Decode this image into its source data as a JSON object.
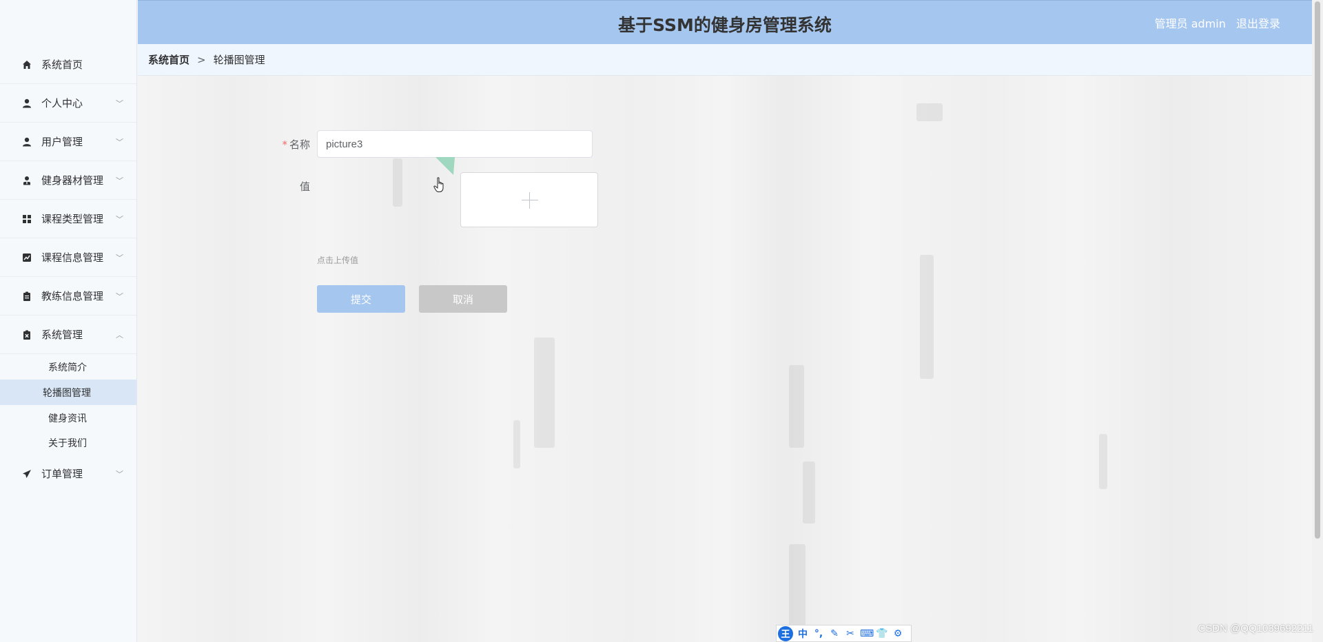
{
  "header": {
    "title": "基于SSM的健身房管理系统",
    "user_label": "管理员 admin",
    "logout_label": "退出登录"
  },
  "breadcrumb": {
    "home": "系统首页",
    "separator": ">",
    "current": "轮播图管理"
  },
  "sidebar": {
    "items": [
      {
        "label": "系统首页",
        "icon": "home-icon"
      },
      {
        "label": "个人中心",
        "icon": "user-icon",
        "expandable": true
      },
      {
        "label": "用户管理",
        "icon": "user-icon",
        "expandable": true
      },
      {
        "label": "健身器材管理",
        "icon": "user-tie-icon",
        "expandable": true
      },
      {
        "label": "课程类型管理",
        "icon": "grid-icon",
        "expandable": true
      },
      {
        "label": "课程信息管理",
        "icon": "chart-icon",
        "expandable": true
      },
      {
        "label": "教练信息管理",
        "icon": "clipboard-icon",
        "expandable": true
      },
      {
        "label": "系统管理",
        "icon": "clipboard-x-icon",
        "expandable": true,
        "expanded": true
      },
      {
        "label": "订单管理",
        "icon": "paper-plane-icon",
        "expandable": true
      }
    ],
    "sub_items": [
      {
        "label": "系统简介"
      },
      {
        "label": "轮播图管理",
        "active": true
      },
      {
        "label": "健身资讯"
      },
      {
        "label": "关于我们"
      }
    ]
  },
  "form": {
    "name_label": "名称",
    "name_required": "*",
    "name_value": "picture3",
    "value_label": "值",
    "upload_hint": "点击上传值",
    "submit_label": "提交",
    "cancel_label": "取消"
  },
  "ime_toolbar": {
    "logo": "王",
    "mode": "中",
    "keys": [
      "°,",
      "✎",
      "✂",
      "⌨",
      "👕",
      "⚙"
    ]
  },
  "watermark": "CSDN @QQ1039692211",
  "colors": {
    "header_bg": "#a5c6ee",
    "submit_bg": "#a5c6ee",
    "cancel_bg": "#c8c8c8",
    "active_menu_bg": "#d9e6f5",
    "required": "#f56c6c"
  }
}
